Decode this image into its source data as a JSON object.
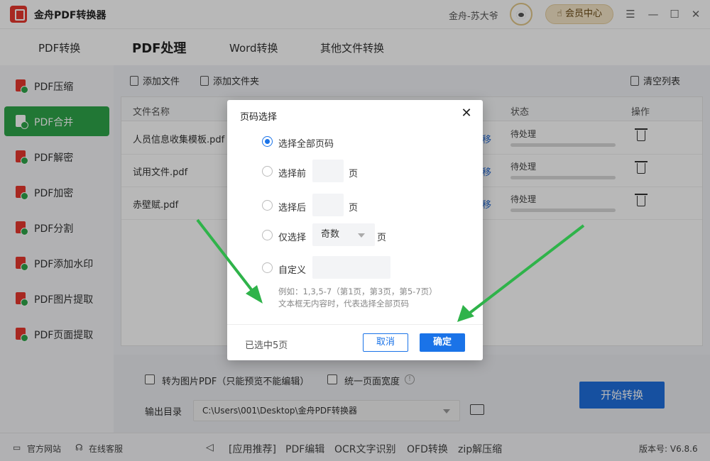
{
  "app": {
    "title": "金舟PDF转换器",
    "username": "金舟-苏大爷",
    "member_center": "会员中心",
    "version": "版本号: V6.8.6"
  },
  "tabs": [
    {
      "label": "PDF转换"
    },
    {
      "label": "PDF处理"
    },
    {
      "label": "Word转换"
    },
    {
      "label": "其他文件转换"
    }
  ],
  "sidebar": {
    "items": [
      {
        "label": "PDF压缩"
      },
      {
        "label": "PDF合并"
      },
      {
        "label": "PDF解密"
      },
      {
        "label": "PDF加密"
      },
      {
        "label": "PDF分割"
      },
      {
        "label": "PDF添加水印"
      },
      {
        "label": "PDF图片提取"
      },
      {
        "label": "PDF页面提取"
      }
    ]
  },
  "toolbar": {
    "add_file": "添加文件",
    "add_folder": "添加文件夹",
    "clear_list": "清空列表"
  },
  "table": {
    "headers": {
      "name": "文件名称",
      "status": "状态",
      "action": "操作"
    },
    "rows": [
      {
        "name": "人员信息收集模板.pdf",
        "move": "移",
        "status": "待处理"
      },
      {
        "name": "试用文件.pdf",
        "move": "移",
        "status": "待处理"
      },
      {
        "name": "赤壁赋.pdf",
        "move": "移",
        "status": "待处理"
      }
    ]
  },
  "options": {
    "to_image_pdf": "转为图片PDF（只能预览不能编辑）",
    "unify_width": "统一页面宽度",
    "output_label": "输出目录",
    "output_path": "C:\\Users\\001\\Desktop\\金舟PDF转换器",
    "start": "开始转换"
  },
  "statusbar": {
    "website": "官方网站",
    "service": "在线客服",
    "links": [
      "[应用推荐]",
      "PDF编辑",
      "OCR文字识别",
      "OFD转换",
      "zip解压缩"
    ]
  },
  "modal": {
    "title": "页码选择",
    "close": "✕",
    "all_pages": "选择全部页码",
    "first_n": "选择前",
    "last_n": "选择后",
    "only": "仅选择",
    "only_value": "奇数",
    "custom": "自定义",
    "page_unit": "页",
    "hint1": "例如：1,3,5-7（第1页，第3页，第5-7页）",
    "hint2": "文本框无内容时，代表选择全部页码",
    "selected_count": "已选中5页",
    "cancel": "取消",
    "ok": "确定"
  },
  "colors": {
    "accent_green": "#2fa54a",
    "primary_blue": "#1a73e8",
    "annotation_arrow": "#2fb34a"
  }
}
